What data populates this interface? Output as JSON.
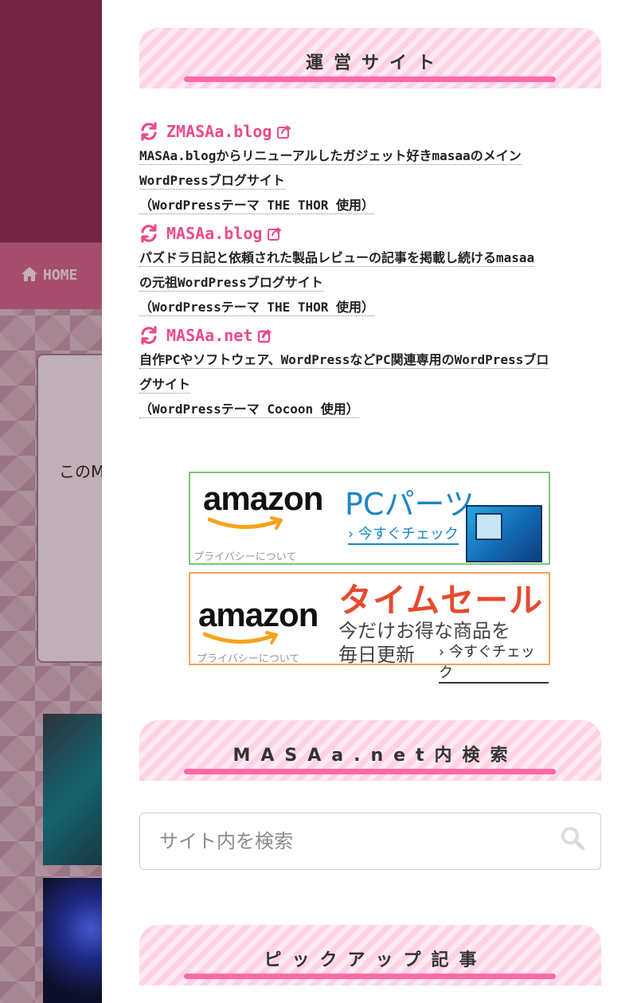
{
  "background": {
    "nav_home_label": "HOME",
    "card_text": "このM"
  },
  "widgets": {
    "sites_title": "運営サイト",
    "search_title": "MASAa.net内検索",
    "pickup_title": "ピックアップ記事"
  },
  "sites": [
    {
      "name": "ZMASAa.blog",
      "desc_lines": [
        "MASAa.blogからリニューアルしたガジェット好きmasaaのメイン",
        "WordPressブログサイト",
        "（WordPressテーマ THE THOR 使用）"
      ]
    },
    {
      "name": "MASAa.blog",
      "desc_lines": [
        "パズドラ日記と依頼された製品レビューの記事を掲載し続けるmasaa",
        "の元祖WordPressブログサイト",
        "（WordPressテーマ THE THOR 使用）"
      ]
    },
    {
      "name": "MASAa.net",
      "desc_lines": [
        "自作PCやソフトウェア、WordPressなどPC関連専用のWordPressブロ",
        "グサイト",
        "（WordPressテーマ Cocoon 使用）"
      ]
    }
  ],
  "banners": {
    "pc": {
      "logo": "amazon",
      "title": "PCパーツ",
      "cta": "今すぐチェック",
      "privacy": "プライバシーについて"
    },
    "sale": {
      "logo": "amazon",
      "title": "タイムセール",
      "line1": "今だけお得な商品を",
      "line2": "毎日更新",
      "cta": "今すぐチェック",
      "privacy": "プライバシーについて"
    }
  },
  "search": {
    "placeholder": "サイト内を検索",
    "value": ""
  },
  "icons": {
    "sync": "sync-icon",
    "external_link": "external-link-icon",
    "search": "search-icon",
    "home": "home-icon"
  },
  "colors": {
    "accent_pink": "#ea4b8c",
    "title_underline": "#ff69a8",
    "header_bg": "#8b2b4f",
    "nav_bg": "#c95f83"
  }
}
